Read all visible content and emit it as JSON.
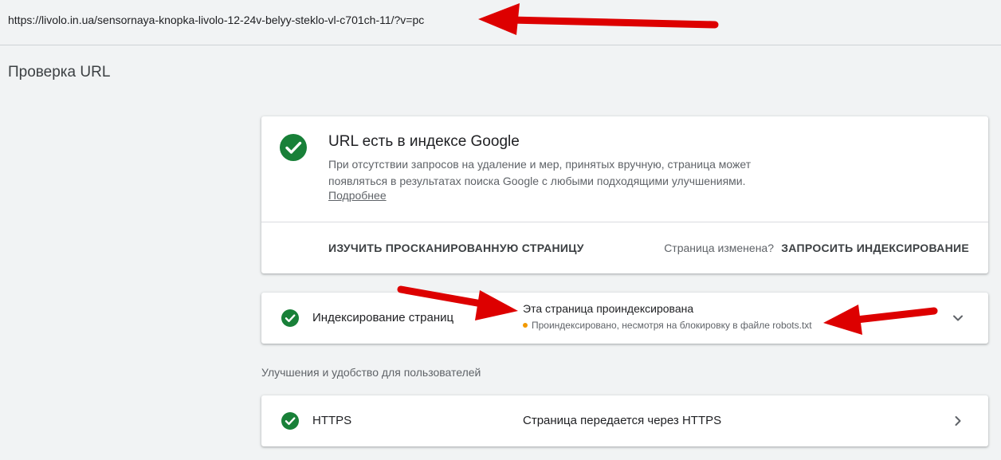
{
  "url_bar": {
    "url": "https://livolo.in.ua/sensornaya-knopka-livolo-12-24v-belyy-steklo-vl-c701ch-11/?v=pc"
  },
  "page": {
    "title": "Проверка URL"
  },
  "result_card": {
    "title": "URL есть в индексе Google",
    "description": "При отсутствии запросов на удаление и мер, принятых вручную, страница может появляться в результатах поиска Google с любыми подходящими улучшениями.",
    "learn_more": "Подробнее",
    "inspect_button": "ИЗУЧИТЬ ПРОСКАНИРОВАННУЮ СТРАНИЦУ",
    "changed_question": "Страница изменена?",
    "request_button": "ЗАПРОСИТЬ ИНДЕКСИРОВАНИЕ"
  },
  "indexing_row": {
    "label": "Индексирование страниц",
    "status": "Эта страница проиндексирована",
    "detail": "Проиндексировано, несмотря на блокировку в файле robots.txt"
  },
  "enhancements": {
    "header": "Улучшения и удобство для пользователей",
    "https_row": {
      "label": "HTTPS",
      "status": "Страница передается через HTTPS"
    }
  },
  "colors": {
    "success_green": "#188038",
    "warning_orange": "#f29900",
    "annotation_red": "#dd0000"
  }
}
